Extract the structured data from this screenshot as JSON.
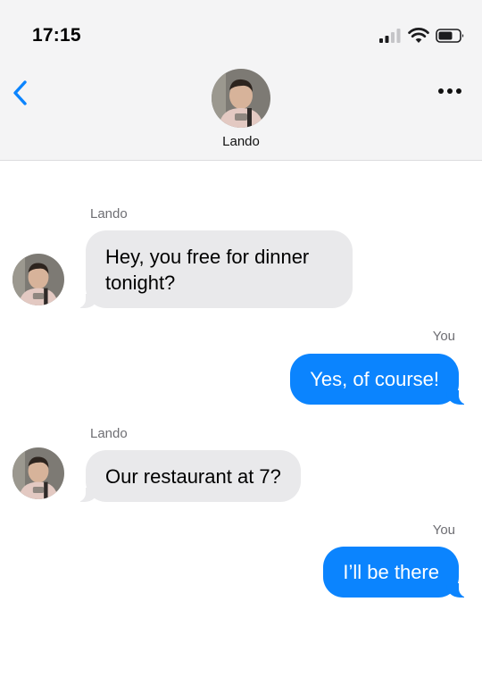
{
  "status_bar": {
    "time": "17:15",
    "icons": [
      "signal-icon",
      "wifi-icon",
      "battery-icon"
    ]
  },
  "header": {
    "contact_name": "Lando",
    "back_icon": "chevron-left-icon",
    "more_icon": "ellipsis-icon"
  },
  "colors": {
    "accent": "#0b84fe",
    "incoming_bubble": "#e9e9eb",
    "header_bg": "#f4f4f5"
  },
  "messages": [
    {
      "sender": "Lando",
      "direction": "incoming",
      "text": "Hey, you free for dinner tonight?"
    },
    {
      "sender": "You",
      "direction": "outgoing",
      "text": "Yes, of course!"
    },
    {
      "sender": "Lando",
      "direction": "incoming",
      "text": "Our restaurant at 7?"
    },
    {
      "sender": "You",
      "direction": "outgoing",
      "text": "I’ll be there"
    }
  ]
}
